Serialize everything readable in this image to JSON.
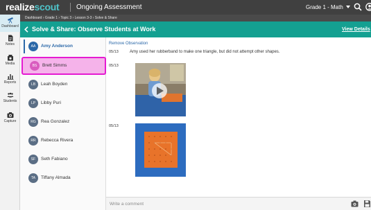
{
  "topbar": {
    "logo_part1": "realize",
    "logo_part2": "scout",
    "app_title": "Ongoing Assessment",
    "grade_selector": "Grade 1 - Math"
  },
  "leftnav": {
    "items": [
      {
        "label": "Dashboard",
        "icon": "telescope-icon"
      },
      {
        "label": "Notes",
        "icon": "notes-icon"
      },
      {
        "label": "Media",
        "icon": "media-icon"
      },
      {
        "label": "Reports",
        "icon": "reports-icon"
      },
      {
        "label": "Students",
        "icon": "students-icon"
      },
      {
        "label": "Capture",
        "icon": "camera-icon"
      }
    ]
  },
  "breadcrumb": "Dashboard › Grade 1 › Topic 3 › Lesson 3-3 › Solve & Share",
  "header": {
    "title": "Solve & Share: Observe Students at Work",
    "view_details": "View Details"
  },
  "students": [
    {
      "initials": "AA",
      "name": "Amy Anderson"
    },
    {
      "initials": "BS",
      "name": "Brett Simms"
    },
    {
      "initials": "LB",
      "name": "Leah Boyden"
    },
    {
      "initials": "LP",
      "name": "Libby Puri"
    },
    {
      "initials": "RG",
      "name": "Rea Gonzalez"
    },
    {
      "initials": "RR",
      "name": "Rebecca Rivera"
    },
    {
      "initials": "SF",
      "name": "Seth Fabiano"
    },
    {
      "initials": "TA",
      "name": "Tiffany Almada"
    }
  ],
  "observations": {
    "remove_label": "Remove Observation",
    "entries": [
      {
        "date": "05/13",
        "text": "Amy used her rubberband to make one triangle, but did not attempt other shapes."
      },
      {
        "date": "05/13",
        "text": ""
      },
      {
        "date": "05/13",
        "text": ""
      }
    ]
  },
  "comment": {
    "placeholder": "Write a comment"
  },
  "colors": {
    "header_green": "#14a091",
    "topbar": "#404040",
    "selected_blue": "#2b68a8",
    "highlight_pink": "#e51ad1"
  }
}
